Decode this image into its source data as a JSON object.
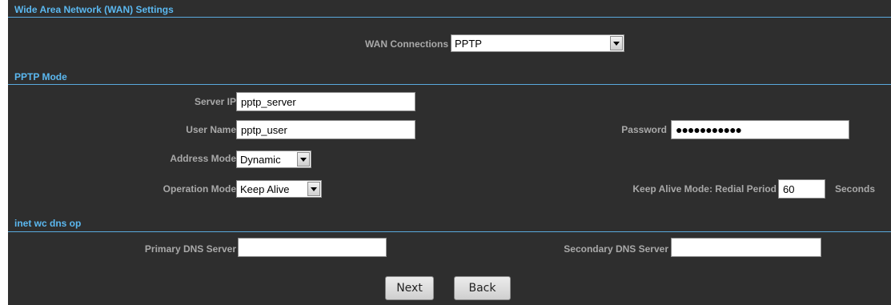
{
  "wan": {
    "title": "Wide Area Network (WAN) Settings",
    "connections_label": "WAN Connections",
    "connections_value": "PPTP"
  },
  "pptp": {
    "title": "PPTP Mode",
    "server_ip_label": "Server IP",
    "server_ip_value": "pptp_server",
    "user_name_label": "User Name",
    "user_name_value": "pptp_user",
    "password_label": "Password",
    "password_value": "●●●●●●●●●●●",
    "address_mode_label": "Address Mode",
    "address_mode_value": "Dynamic",
    "operation_mode_label": "Operation Mode",
    "operation_mode_value": "Keep Alive",
    "redial_label": "Keep Alive Mode: Redial Period",
    "redial_value": "60",
    "redial_unit": "Seconds"
  },
  "dns": {
    "title": "inet wc dns op",
    "primary_label": "Primary DNS Server",
    "primary_value": "",
    "secondary_label": "Secondary DNS Server",
    "secondary_value": ""
  },
  "buttons": {
    "next": "Next",
    "back": "Back"
  },
  "colors": {
    "panel_bg": "#2e2e2e",
    "section_title": "#5bb8f0",
    "label": "#a9a9a9"
  }
}
